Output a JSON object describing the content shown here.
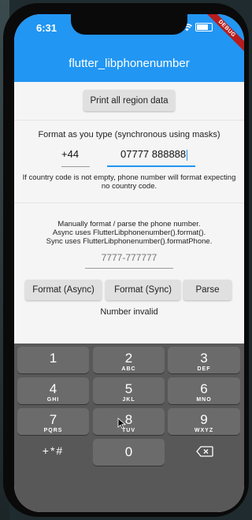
{
  "status": {
    "time": "6:31"
  },
  "debug_banner": "DEBUG",
  "appbar": {
    "title": "flutter_libphonenumber"
  },
  "print_button": "Print all region data",
  "format_section": {
    "heading": "Format as you type (synchronous using masks)",
    "country_code": "+44",
    "phone_value": "07777 888888",
    "note": "If country code is not empty, phone number will format expecting no country code."
  },
  "manual_section": {
    "line1": "Manually format / parse the phone number.",
    "line2": "Async uses FlutterLibphonenumber().format().",
    "line3": "Sync uses FlutterLibphonenumber().formatPhone.",
    "input_placeholder": "7777-777777",
    "buttons": {
      "format_async": "Format (Async)",
      "format_sync": "Format (Sync)",
      "parse": "Parse"
    },
    "result": "Number invalid"
  },
  "keypad": {
    "keys": [
      {
        "num": "1",
        "letters": ""
      },
      {
        "num": "2",
        "letters": "ABC"
      },
      {
        "num": "3",
        "letters": "DEF"
      },
      {
        "num": "4",
        "letters": "GHI"
      },
      {
        "num": "5",
        "letters": "JKL"
      },
      {
        "num": "6",
        "letters": "MNO"
      },
      {
        "num": "7",
        "letters": "PQRS"
      },
      {
        "num": "8",
        "letters": "TUV"
      },
      {
        "num": "9",
        "letters": "WXYZ"
      }
    ],
    "symbols": "+*#",
    "zero": "0"
  },
  "colors": {
    "appbar": "#2196f3",
    "accent": "#2196f3",
    "keyboard": "#585858",
    "key": "#6b6b6b"
  },
  "icons": [
    "wifi-icon",
    "battery-icon",
    "backspace-icon",
    "mouse-cursor-icon"
  ]
}
